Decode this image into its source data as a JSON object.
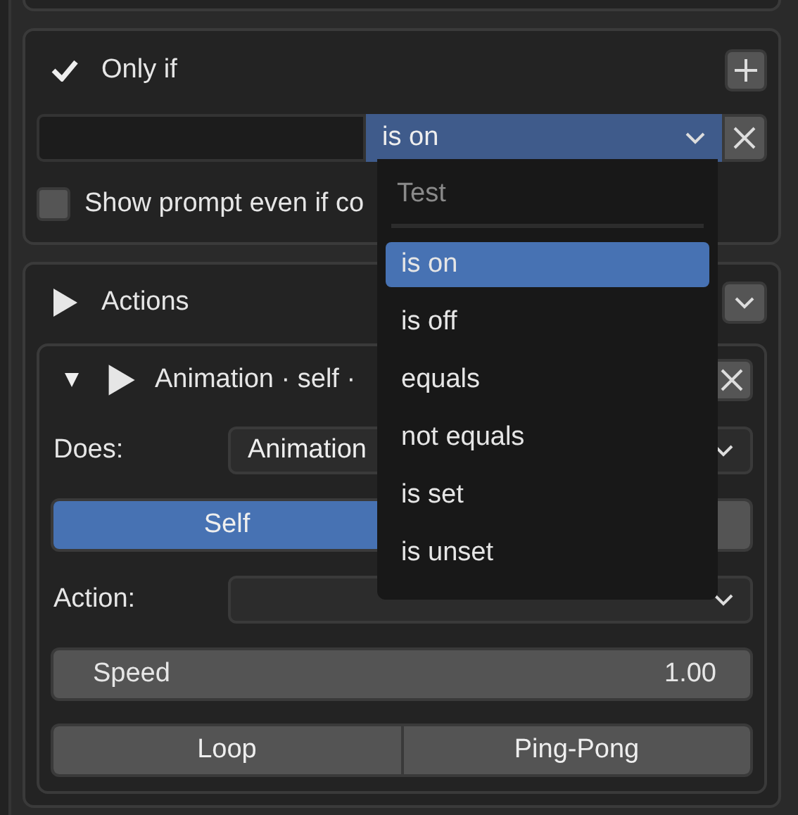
{
  "condition_panel": {
    "title": "Only if",
    "enabled": true,
    "operator": {
      "value": "is on",
      "open": true
    },
    "prompt_checkbox": {
      "label": "Show prompt even if co",
      "checked": false
    }
  },
  "dropdown": {
    "title": "Test",
    "items": [
      {
        "label": "is on",
        "selected": true
      },
      {
        "label": "is off",
        "selected": false
      },
      {
        "label": "equals",
        "selected": false
      },
      {
        "label": "not equals",
        "selected": false
      },
      {
        "label": "is set",
        "selected": false
      },
      {
        "label": "is unset",
        "selected": false
      }
    ]
  },
  "actions_panel": {
    "title": "Actions",
    "action": {
      "title": "Animation · self ·",
      "expanded": true,
      "does_label": "Does:",
      "does_value": "Animation",
      "targets": [
        {
          "label": "Self",
          "selected": true
        },
        {
          "selected": false
        }
      ],
      "action_label": "Action:",
      "speed": {
        "label": "Speed",
        "value": "1.00"
      },
      "modes": [
        {
          "label": "Loop",
          "selected": false
        },
        {
          "label": "Ping-Pong",
          "selected": false
        }
      ]
    }
  }
}
